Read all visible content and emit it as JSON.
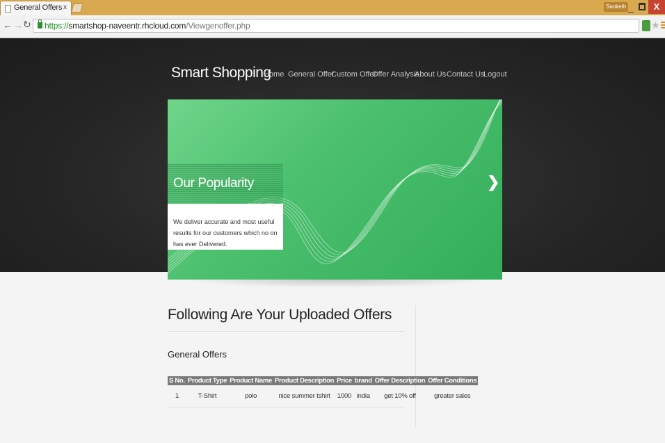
{
  "browser": {
    "tab_title": "General Offers",
    "tab_close": "x",
    "user": "Sanketh",
    "minimize": "_",
    "close": "X",
    "url_scheme": "https://",
    "url_host": "smartshop-naveentr.rhcloud.com",
    "url_path": "/Viewgenoffer.php"
  },
  "site": {
    "brand": "Smart Shopping",
    "nav": [
      "Home",
      "General Offer",
      "Custom Offer",
      "Offer Analysis",
      "About Us",
      "Contact Us",
      "Logout"
    ]
  },
  "slider": {
    "title": "Our Popularity",
    "text": "We deliver accurate and most useful results for our customers which no on has ever Delivered.",
    "next": "❯"
  },
  "main": {
    "heading": "Following Are Your Uploaded Offers",
    "subheading": "General Offers",
    "table": {
      "headers": [
        "S No.",
        "Product Type",
        "Product Name",
        "Product Description",
        "Price",
        "brand",
        "Offer Description",
        "Offer Conditions"
      ],
      "rows": [
        [
          "1",
          "T-Shirt",
          "polo",
          "nice summer tshirt",
          "1000",
          "india",
          "get 10% off",
          "greater sales"
        ]
      ]
    }
  }
}
